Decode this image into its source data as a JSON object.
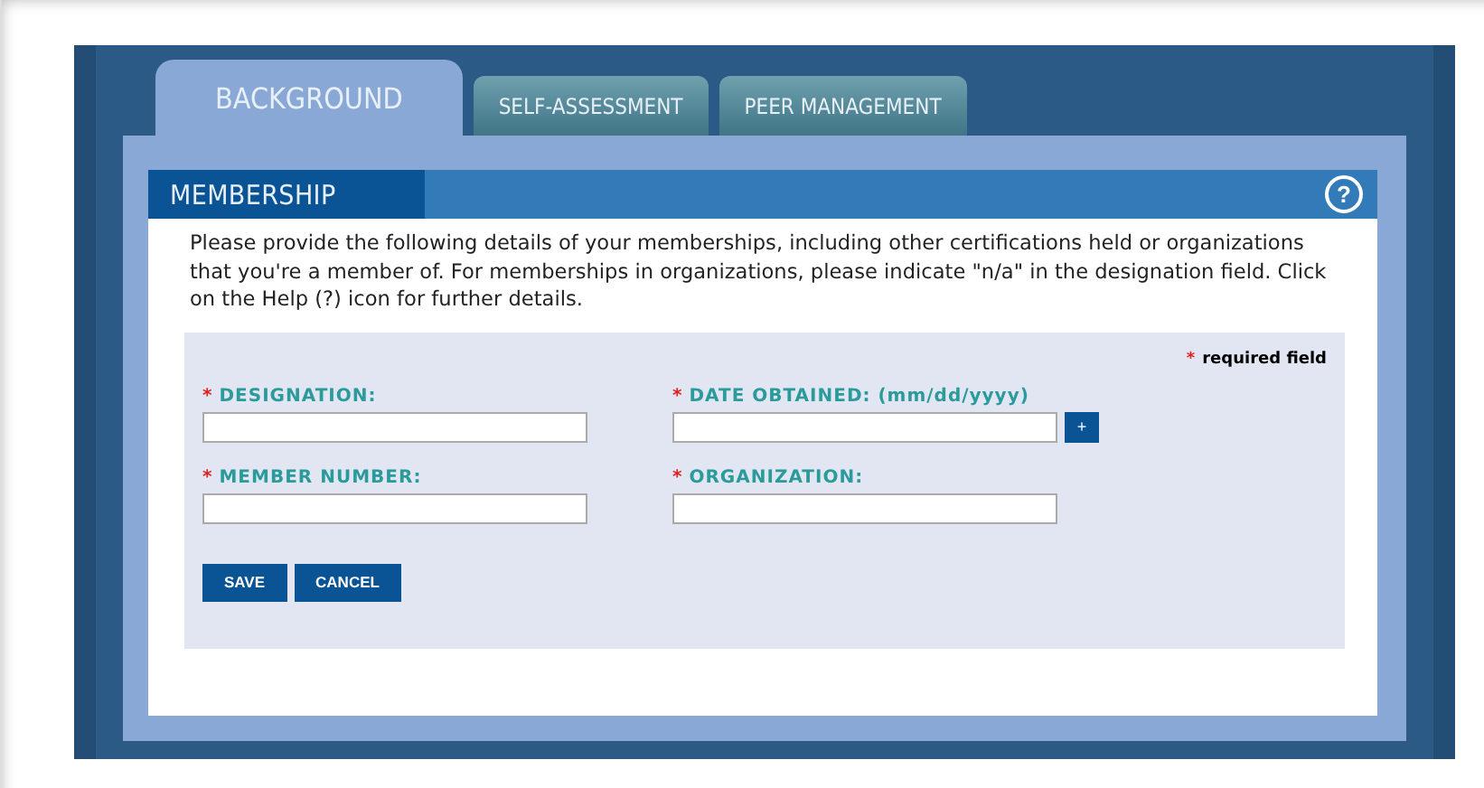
{
  "tabs": [
    {
      "label": "BACKGROUND",
      "selected": true
    },
    {
      "label": "SELF-ASSESSMENT",
      "selected": false
    },
    {
      "label": "PEER MANAGEMENT",
      "selected": false
    }
  ],
  "section": {
    "title": "MEMBERSHIP",
    "help": "?"
  },
  "intro": "Please provide the following details of your memberships, including other certifications held or organizations that you're a member of.  For memberships in organizations, please indicate \"n/a\" in the designation field.  Click on the Help (?) icon for further details.",
  "required_note": {
    "mark": "*",
    "text": "required field"
  },
  "fields": [
    {
      "mark": "*",
      "label": "DESIGNATION:",
      "kind": "text"
    },
    {
      "mark": "*",
      "label": "DATE OBTAINED: (mm/dd/yyyy)",
      "kind": "date",
      "picker": "+"
    },
    {
      "mark": "*",
      "label": "MEMBER NUMBER:",
      "kind": "text"
    },
    {
      "mark": "*",
      "label": "ORGANIZATION:",
      "kind": "text"
    }
  ],
  "buttons": [
    "SAVE",
    "CANCEL"
  ]
}
